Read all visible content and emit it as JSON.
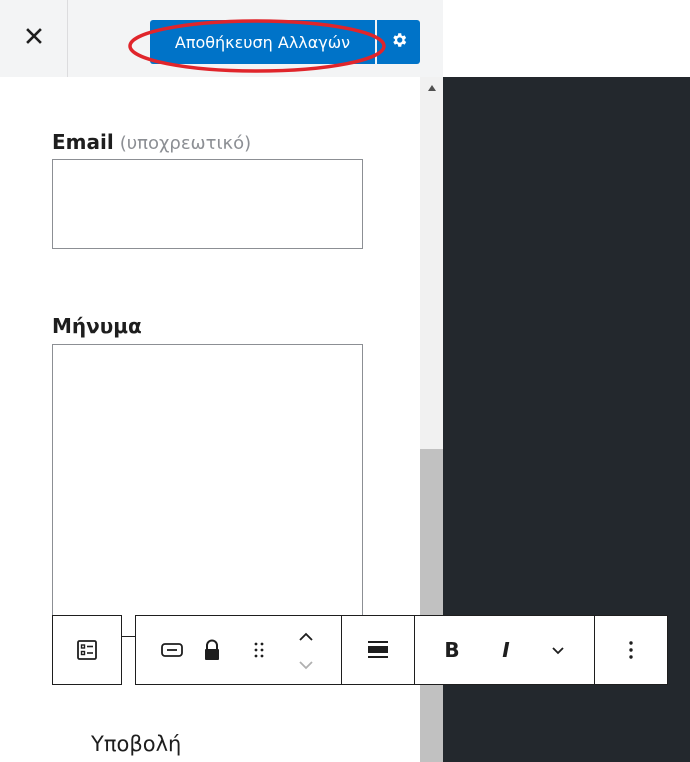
{
  "header": {
    "save_label": "Αποθήκευση Αλλαγών",
    "close_icon": "close-icon",
    "settings_icon": "gear-icon",
    "accent_color": "#0073c8",
    "highlight_color": "#e0252b"
  },
  "form": {
    "email_label": "Email",
    "email_required": "(υποχρεωτικό)",
    "message_label": "Μήνυμα",
    "submit_label": "Υποβολή"
  },
  "block_toolbar": {
    "icons": [
      "form-block-icon",
      "input-field-icon",
      "lock-icon",
      "drag-handle-icon",
      "move-up-icon",
      "move-down-icon",
      "align-icon",
      "bold-icon",
      "italic-icon",
      "more-rich-text-icon",
      "options-icon"
    ],
    "bold": "B",
    "italic": "I"
  },
  "preview": {
    "background": "#23282d"
  }
}
